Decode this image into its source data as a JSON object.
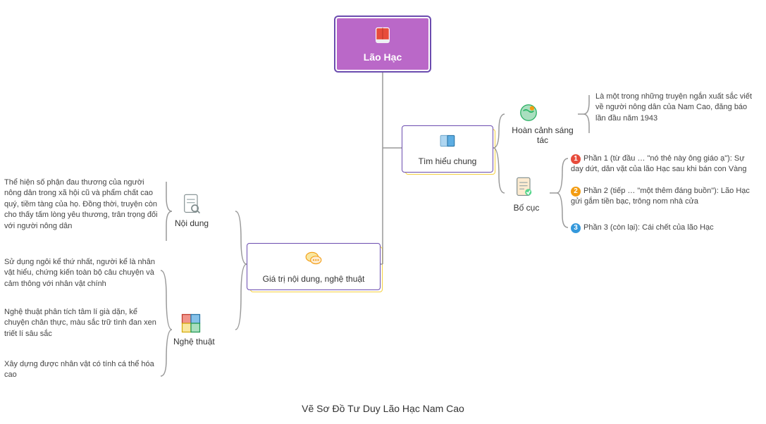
{
  "root": {
    "title": "Lão Hạc"
  },
  "branches": {
    "general": {
      "title": "Tìm hiểu chung",
      "context": {
        "label": "Hoàn cảnh sáng tác",
        "text": "Là một trong những truyện ngắn xuất sắc viết về người nông dân của Nam Cao, đăng báo lần đầu năm 1943"
      },
      "layout": {
        "label": "Bố cục",
        "parts": [
          "Phần 1 (từ đầu … \"nó thẻ này ông giáo ạ\"): Sự day dứt, dăn vặt của lão Hạc sau khi bán con Vàng",
          "Phần 2 (tiếp … \"một thêm đáng buồn\"): Lão Hạc gửi gắm tiền bạc, trông nom nhà cửa",
          "Phần 3 (còn lại): Cái chết của lão Hạc"
        ]
      }
    },
    "value": {
      "title": "Giá trị nội dung, nghệ thuật",
      "content": {
        "label": "Nội dung",
        "text": "Thể hiện số phận đau thương của người nông dân trong xã hội cũ và phẩm chất cao quý, tiềm tàng của họ. Đồng thời, truyện còn cho thấy tấm lòng yêu thương, trân trọng đối với người nông dân"
      },
      "art": {
        "label": "Nghệ thuật",
        "points": [
          "Sử dụng ngôi kể thứ nhất, người kể là nhân vật hiểu, chứng kiến toàn bộ câu chuyện và cảm thông với nhân vật chính",
          "Nghệ thuật phân tích tâm lí già dặn, kể chuyện chân thực, màu sắc trữ tình đan xen triết lí sâu sắc",
          "Xây dựng được nhân vật có tính cá thể hóa cao"
        ]
      }
    }
  },
  "caption": "Vẽ Sơ Đồ Tư Duy Lão Hạc Nam Cao"
}
